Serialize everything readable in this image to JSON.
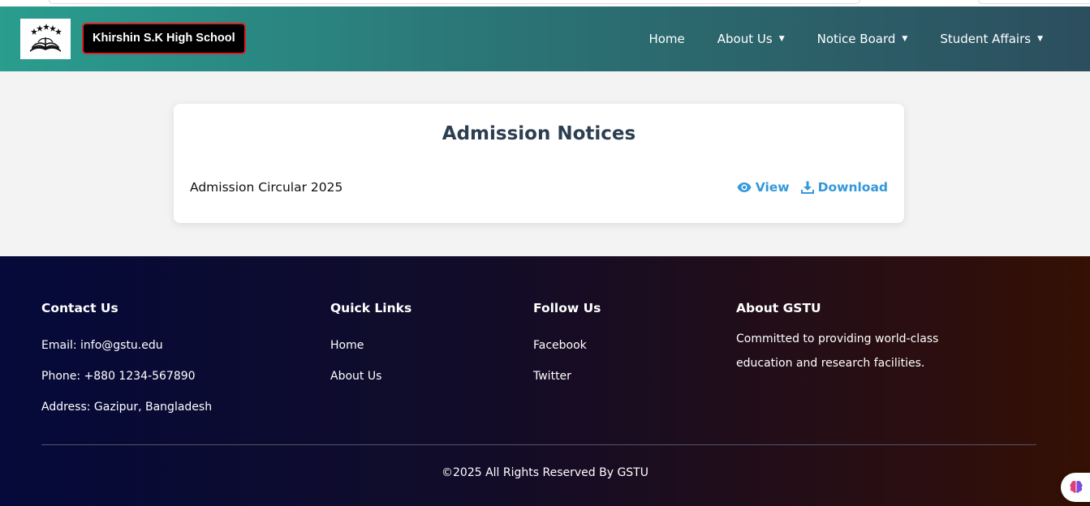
{
  "header": {
    "school_name": "Khirshin S.K High School",
    "nav": [
      {
        "label": "Home",
        "has_dropdown": false
      },
      {
        "label": "About Us",
        "has_dropdown": true
      },
      {
        "label": "Notice Board",
        "has_dropdown": true
      },
      {
        "label": "Student Affairs",
        "has_dropdown": true
      }
    ],
    "caret": "▼"
  },
  "main": {
    "title": "Admission Notices",
    "notices": [
      {
        "title": "Admission Circular 2025",
        "view_label": "View",
        "download_label": "Download"
      }
    ]
  },
  "footer": {
    "contact": {
      "heading": "Contact Us",
      "email": "Email: info@gstu.edu",
      "phone": "Phone: +880 1234-567890",
      "address": "Address: Gazipur, Bangladesh"
    },
    "quick_links": {
      "heading": "Quick Links",
      "items": [
        "Home",
        "About Us"
      ]
    },
    "follow": {
      "heading": "Follow Us",
      "items": [
        "Facebook",
        "Twitter"
      ]
    },
    "about": {
      "heading": "About GSTU",
      "text": "Committed to providing world-class education and research facilities."
    },
    "copyright": "©2025 All Rights Reserved By GSTU"
  },
  "icons": {
    "logo": "book-stars-logo",
    "view": "eye-icon",
    "download": "download-icon",
    "assistant": "brain-icon"
  },
  "colors": {
    "nav_gradient_start": "#2a9d8f",
    "nav_gradient_end": "#2c4e5e",
    "title": "#2c3e50",
    "link": "#3498db",
    "footer_start": "#050a3a",
    "footer_end": "#351003",
    "school_name_border": "#dd2222"
  }
}
